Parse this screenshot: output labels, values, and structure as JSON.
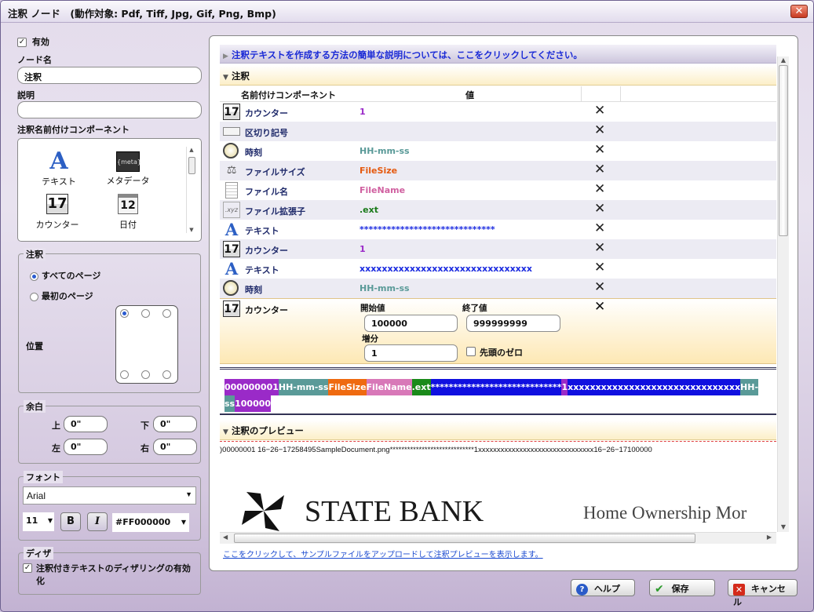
{
  "window": {
    "title": "注釈 ノード　(動作対象: Pdf, Tiff, Jpg, Gif, Png, Bmp)",
    "close": "✕"
  },
  "left": {
    "enabled_label": "有効",
    "node_name_label": "ノード名",
    "node_name_value": "注釈",
    "desc_label": "説明",
    "desc_value": "",
    "components_label": "注釈名前付けコンポーネント",
    "components": [
      {
        "label": "テキスト",
        "icon": "A"
      },
      {
        "label": "メタデータ",
        "icon": "{meta}"
      },
      {
        "label": "カウンター",
        "icon": "17"
      },
      {
        "label": "日付",
        "icon": "12"
      }
    ],
    "annot_group": "注釈",
    "all_pages": "すべてのページ",
    "first_page": "最初のページ",
    "position_label": "位置",
    "margin_group": "余白",
    "top": "上",
    "bottom": "下",
    "left": "左",
    "right": "右",
    "margin_top": "0\"",
    "margin_bottom": "0\"",
    "margin_left": "0\"",
    "margin_right": "0\"",
    "font_group": "フォント",
    "font_name": "Arial",
    "font_size": "11",
    "bold": "B",
    "italic": "I",
    "color": "#FF000000",
    "dither_group": "ディザ",
    "dither_label": "注釈付きテキストのディザリングの有効化"
  },
  "right": {
    "help_link": "注釈テキストを作成する方法の簡単な説明については、ここをクリックしてください。",
    "annot_header": "注釈",
    "col_component": "名前付けコンポーネント",
    "col_value": "値",
    "rows": [
      {
        "name": "カウンター",
        "value": "1",
        "color": "#9a2ac8",
        "icon": "17"
      },
      {
        "name": "区切り記号",
        "value": "",
        "color": "#000",
        "icon": "sep"
      },
      {
        "name": "時刻",
        "value": "HH-mm-ss",
        "color": "#5a9a98",
        "icon": "clock"
      },
      {
        "name": "ファイルサイズ",
        "value": "FileSize",
        "color": "#e55a10",
        "icon": "scale"
      },
      {
        "name": "ファイル名",
        "value": "FileName",
        "color": "#d060a0",
        "icon": "doc"
      },
      {
        "name": "ファイル拡張子",
        "value": ".ext",
        "color": "#1a7a1a",
        "icon": "xyz"
      },
      {
        "name": "テキスト",
        "value": "******************************",
        "color": "#1a2ae0",
        "icon": "A"
      },
      {
        "name": "カウンター",
        "value": "1",
        "color": "#9a2ac8",
        "icon": "17"
      },
      {
        "name": "テキスト",
        "value": "xxxxxxxxxxxxxxxxxxxxxxxxxxxxxxx",
        "color": "#1a2ae0",
        "icon": "A"
      },
      {
        "name": "時刻",
        "value": "HH-mm-ss",
        "color": "#5a9a98",
        "icon": "clock"
      }
    ],
    "edit_row": {
      "name": "カウンター",
      "start_label": "開始値",
      "end_label": "終了値",
      "step_label": "増分",
      "start": "100000",
      "end": "999999999",
      "step": "1",
      "zero_label": "先頭のゼロ"
    },
    "segments": [
      {
        "text": "000000001",
        "color": "#9a2ac8"
      },
      {
        "text": " ",
        "color": "#000000"
      },
      {
        "text": "HH-mm-ss",
        "color": "#5a9a98"
      },
      {
        "text": "FileSize",
        "color": "#ef6a10"
      },
      {
        "text": "FileName",
        "color": "#d878b8"
      },
      {
        "text": ".ext",
        "color": "#1a8a1a"
      },
      {
        "text": "*****************************",
        "color": "#1010e0"
      },
      {
        "text": "1",
        "color": "#9a2ac8"
      },
      {
        "text": "xxxxxxxxxxxxxxxxxxxxxxxxxxxxxxx",
        "color": "#1010e0"
      },
      {
        "text": "HH-",
        "color": "#5a9a98"
      }
    ],
    "segments2": [
      {
        "text": "ss",
        "color": "#5a9a98"
      },
      {
        "text": "100000",
        "color": "#9a2ac8"
      }
    ],
    "preview_header": "注釈のプレビュー",
    "preview_text": ")00000001 16−26−17258495SampleDocument.png*****************************1xxxxxxxxxxxxxxxxxxxxxxxxxxxxxxx16−26−17100000",
    "bank_name": "STATE BANK",
    "bank_tag": "Home Ownership Mor",
    "upload_link": "ここをクリックして、サンプルファイルをアップロードして注釈プレビューを表示します。"
  },
  "buttons": {
    "help": "ヘルプ",
    "save": "保存",
    "cancel": "キャンセル"
  }
}
